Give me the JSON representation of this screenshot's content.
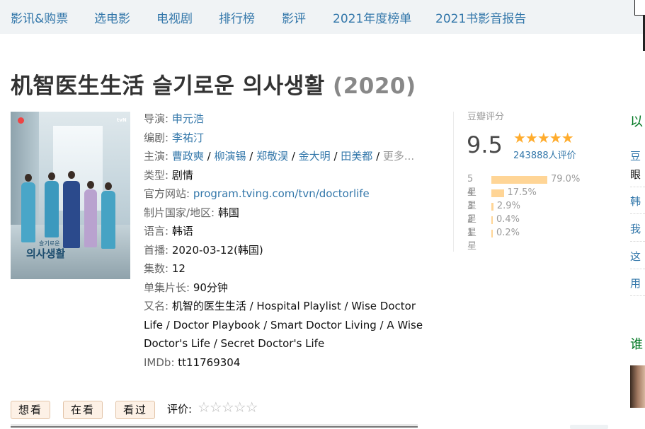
{
  "nav": {
    "items": [
      "影讯&购票",
      "选电影",
      "电视剧",
      "排行榜",
      "影评",
      "2021年度榜单",
      "2021书影音报告"
    ]
  },
  "title": {
    "name": "机智医生生活 슬기로운 의사생활",
    "year": "(2020)"
  },
  "poster": {
    "korean_title": "의사생활",
    "small_title": "슬기로운",
    "brand": "tvN"
  },
  "info": {
    "director_label": "导演:",
    "director": "申元浩",
    "writer_label": "编剧:",
    "writer": "李祐汀",
    "cast_label": "主演:",
    "cast": [
      "曹政奭",
      "柳演锡",
      "郑敬淏",
      "金大明",
      "田美都"
    ],
    "cast_sep": " / ",
    "cast_more": "更多...",
    "genre_label": "类型:",
    "genre": "剧情",
    "site_label": "官方网站:",
    "site": "program.tving.com/tvn/doctorlife",
    "country_label": "制片国家/地区:",
    "country": "韩国",
    "language_label": "语言:",
    "language": "韩语",
    "premiere_label": "首播:",
    "premiere": "2020-03-12(韩国)",
    "episodes_label": "集数:",
    "episodes": "12",
    "runtime_label": "单集片长:",
    "runtime": "90分钟",
    "aka_label": "又名:",
    "aka": "机智的医生生活 / Hospital Playlist / Wise Doctor Life / Doctor Playbook / Smart Doctor Living / A Wise Doctor's Life / Secret Doctor's Life",
    "imdb_label": "IMDb:",
    "imdb": "tt11769304"
  },
  "rating": {
    "label": "豆瓣评分",
    "score": "9.5",
    "stars": "★★★★★",
    "votes": "243888人评价",
    "distribution": [
      {
        "label": "5星",
        "percent": 79.0,
        "text": "79.0%"
      },
      {
        "label": "4星",
        "percent": 17.5,
        "text": "17.5%"
      },
      {
        "label": "3星",
        "percent": 2.9,
        "text": "2.9%"
      },
      {
        "label": "2星",
        "percent": 0.4,
        "text": "0.4%"
      },
      {
        "label": "1星",
        "percent": 0.2,
        "text": "0.2%"
      }
    ]
  },
  "side": {
    "head1": "以",
    "line1": "豆",
    "line1b": "眼",
    "line2": "韩",
    "line3": "我",
    "line4": "这",
    "line5": "用",
    "head2": "谁"
  },
  "actions": {
    "want": "想看",
    "watching": "在看",
    "watched": "看过",
    "rate_label": "评价:",
    "rate_stars": "☆☆☆☆☆"
  },
  "colors": {
    "link": "#3377aa",
    "star": "#ffac2d",
    "bar": "#ffd596",
    "side_head": "#007722"
  }
}
